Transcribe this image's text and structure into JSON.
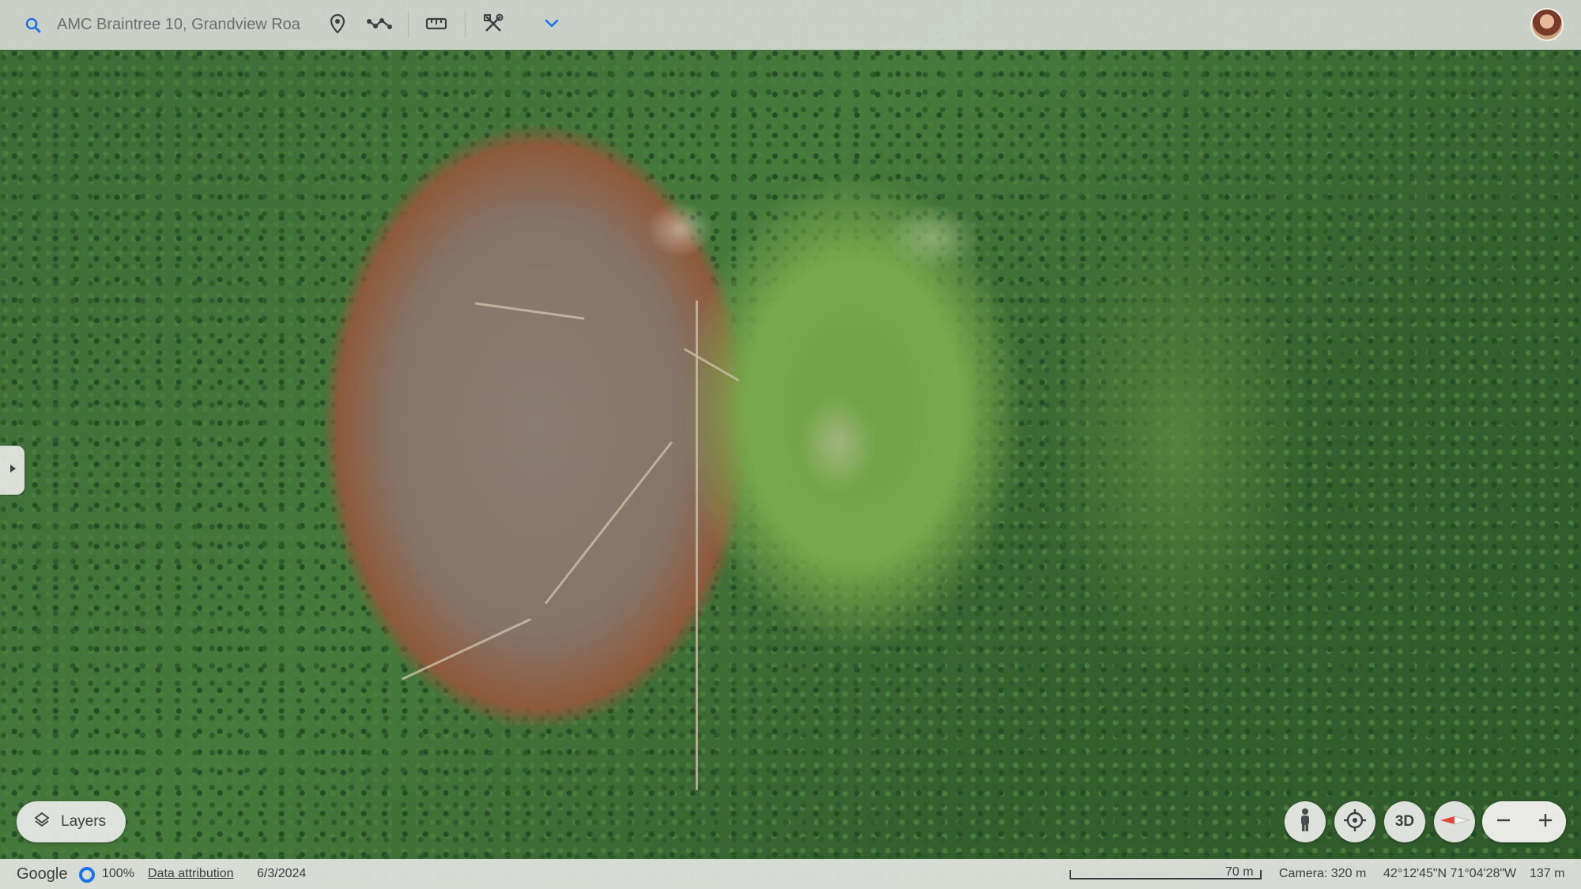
{
  "search": {
    "placeholder": "AMC Braintree 10, Grandview Roa"
  },
  "toolbar": {
    "icons": [
      "search-icon",
      "place-pin-icon",
      "path-icon",
      "ruler-icon",
      "tools-icon",
      "chevron-down-icon"
    ],
    "accent_color": "#1a73e8"
  },
  "layers": {
    "label": "Layers"
  },
  "controls": {
    "label_3d": "3D"
  },
  "status": {
    "brand": "Google",
    "progress": "100%",
    "attribution": "Data attribution",
    "imagery_date": "6/3/2024",
    "scale": "70 m",
    "camera": "Camera: 320 m",
    "coordinates": "42°12'45\"N 71°04'28\"W",
    "elevation": "137 m"
  }
}
